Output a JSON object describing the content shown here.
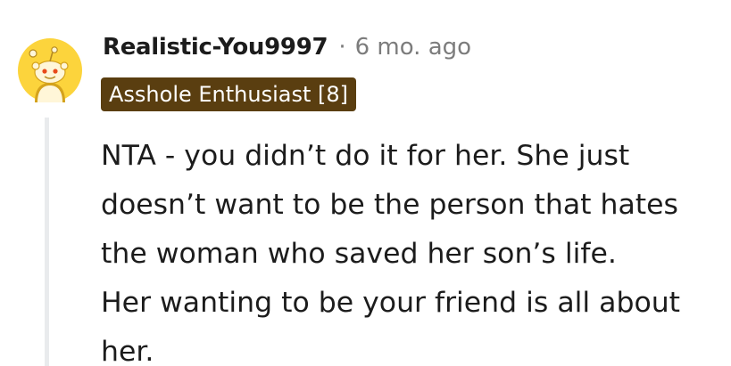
{
  "comment": {
    "author": "Realistic-You9997",
    "separator": "·",
    "timestamp": "6 mo. ago",
    "flair": "Asshole Enthusiast [8]",
    "avatar": "snoo-avatar-icon",
    "body_lines": [
      "NTA - you didn’t do it for her. She just",
      "doesn’t want to be the person that hates",
      "the woman who saved her son’s life.",
      "Her wanting to be your friend is all about",
      "her."
    ]
  },
  "colors": {
    "avatar_bg": "#fcd43c",
    "flair_bg": "#5a3e10",
    "text": "#1c1c1c",
    "muted": "#7c7c7c",
    "thread_line": "#e9ebed"
  }
}
